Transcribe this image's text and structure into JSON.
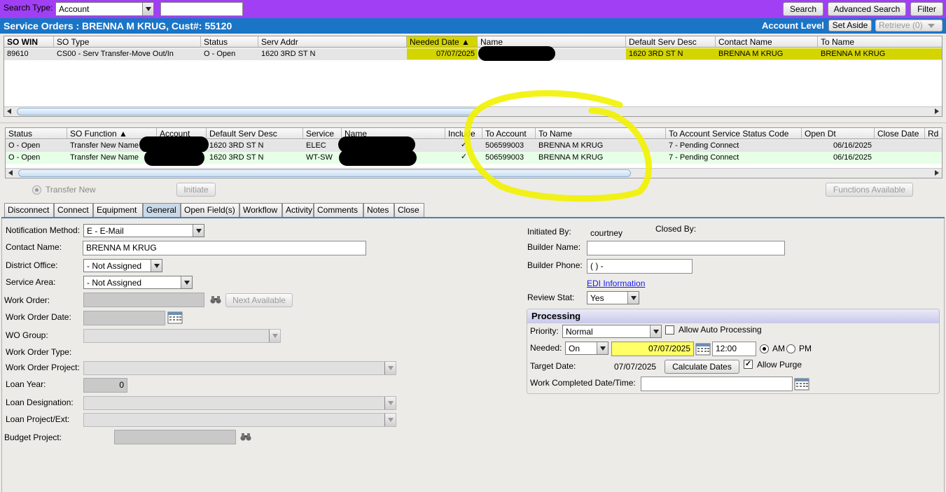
{
  "topbar": {
    "search_type_label": "Search Type:",
    "search_type_value": "Account",
    "search_input_value": "",
    "search_button": "Search",
    "advanced_search_button": "Advanced Search",
    "filter_button": "Filter"
  },
  "titlebar": {
    "title": "Service Orders : BRENNA M KRUG, Cust#: 55120",
    "account_level": "Account Level",
    "set_aside_button": "Set Aside",
    "retrieve_button": "Retrieve (0)"
  },
  "so_grid": {
    "columns": [
      "SO WIN",
      "SO Type",
      "Status",
      "Serv Addr",
      "Needed Date ▲",
      "Name",
      "Default Serv Desc",
      "Contact Name",
      "To Name"
    ],
    "rows": [
      {
        "so_win": "89610",
        "so_type": "CS00 - Serv Transfer-Move Out/In",
        "status": "O - Open",
        "serv_addr": "1620 3RD ST N",
        "needed_date": "07/07/2025",
        "name": "",
        "default_serv_desc": "1620 3RD ST N",
        "contact_name": "BRENNA M KRUG",
        "to_name": "BRENNA M KRUG"
      }
    ]
  },
  "fn_grid": {
    "columns": [
      "Status",
      "SO Function ▲",
      "Account",
      "Default Serv Desc",
      "Service",
      "Name",
      "Include",
      "To Account",
      "To Name",
      "To Account Service Status Code",
      "Open Dt",
      "Close Date",
      "Rd"
    ],
    "rows": [
      {
        "status": "O - Open",
        "so_function": "Transfer New Name",
        "account": "",
        "default_serv_desc": "1620 3RD ST N",
        "service": "ELEC",
        "name": "",
        "include": "✓",
        "to_account": "506599003",
        "to_name": "BRENNA M KRUG",
        "status_code": "7 - Pending Connect",
        "open_dt": "06/16/2025",
        "close_date": ""
      },
      {
        "status": "O - Open",
        "so_function": "Transfer New Name",
        "account": "",
        "default_serv_desc": "1620 3RD ST N",
        "service": "WT-SW",
        "name": "",
        "include": "✓",
        "to_account": "506599003",
        "to_name": "BRENNA M KRUG",
        "status_code": "7 - Pending Connect",
        "open_dt": "06/16/2025",
        "close_date": ""
      }
    ]
  },
  "actions": {
    "transfer_new_label": "Transfer New",
    "initiate_button": "Initiate",
    "functions_available_button": "Functions Available"
  },
  "tabs": [
    "Disconnect",
    "Connect",
    "Equipment",
    "General",
    "Open Field(s)",
    "Workflow",
    "Activity",
    "Comments",
    "Notes",
    "Close"
  ],
  "general": {
    "notification_method_label": "Notification Method:",
    "notification_method_value": "E - E-Mail",
    "contact_name_label": "Contact Name:",
    "contact_name_value": "BRENNA M KRUG",
    "district_office_label": "District Office:",
    "district_office_value": "- Not Assigned",
    "service_area_label": "Service Area:",
    "service_area_value": "- Not Assigned",
    "work_order_label": "Work Order:",
    "next_available_button": "Next Available",
    "work_order_date_label": "Work Order Date:",
    "wo_group_label": "WO Group:",
    "work_order_type_label": "Work Order Type:",
    "work_order_project_label": "Work Order Project:",
    "loan_year_label": "Loan Year:",
    "loan_year_value": "0",
    "loan_designation_label": "Loan Designation:",
    "loan_project_label": "Loan Project/Ext:",
    "budget_project_label": "Budget Project:",
    "initiated_by_label": "Initiated By:",
    "initiated_by_value": "courtney",
    "closed_by_label": "Closed By:",
    "builder_name_label": "Builder Name:",
    "builder_phone_label": "Builder Phone:",
    "builder_phone_value": "(  )  -",
    "edi_link": "EDI Information",
    "review_stat_label": "Review Stat:",
    "review_stat_value": "Yes"
  },
  "processing": {
    "header": "Processing",
    "priority_label": "Priority:",
    "priority_value": "Normal",
    "allow_auto_label": "Allow Auto Processing",
    "needed_label": "Needed:",
    "needed_mode": "On",
    "needed_date": "07/07/2025",
    "needed_time": "12:00",
    "am_label": "AM",
    "pm_label": "PM",
    "target_date_label": "Target Date:",
    "target_date_value": "07/07/2025",
    "calculate_dates_button": "Calculate Dates",
    "allow_purge_label": "Allow Purge",
    "work_completed_label": "Work Completed Date/Time:"
  },
  "colors": {
    "topbar": "#a13ff4",
    "titlebar": "#1a75c7",
    "highlight": "#d4d400",
    "annotation": "#f2f200",
    "needed_field": "#ffff66",
    "selected_row": "#e6ffe6"
  }
}
